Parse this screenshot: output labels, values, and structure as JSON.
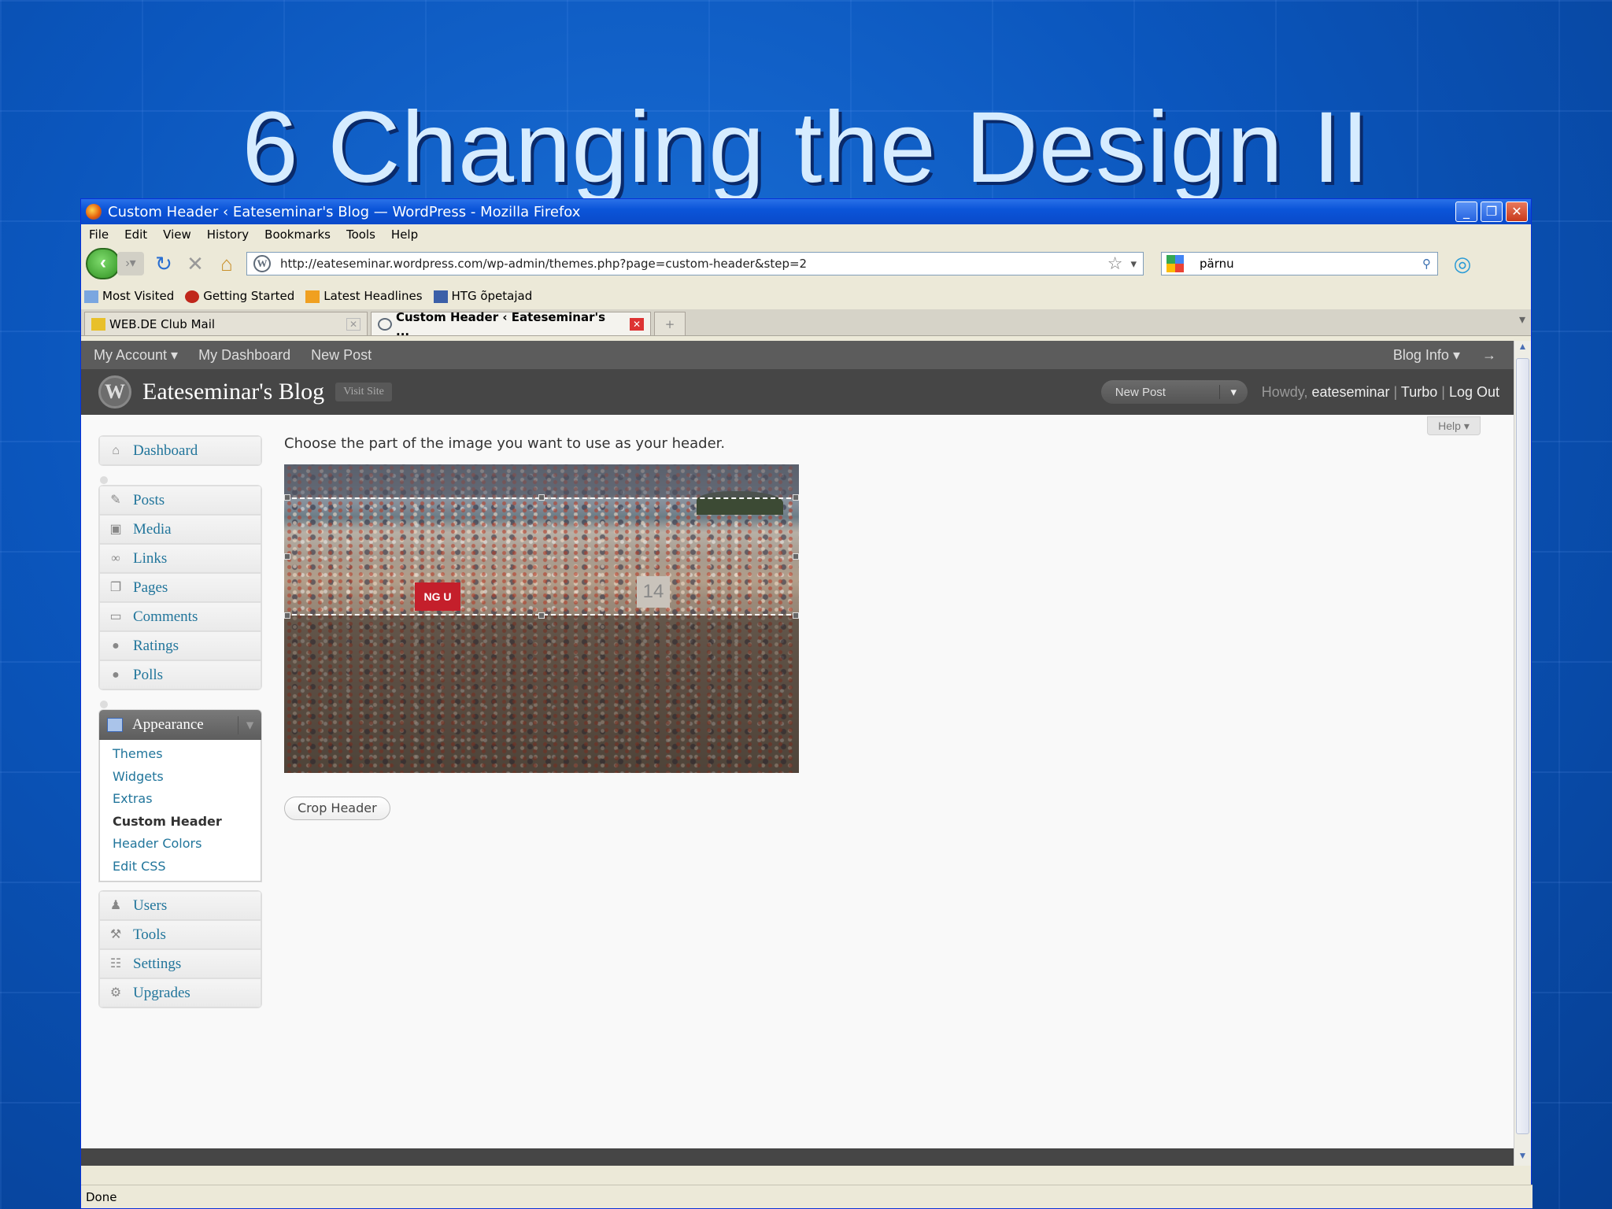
{
  "slide": {
    "title": "6 Changing the Design II"
  },
  "browser": {
    "window_title": "Custom Header ‹ Eateseminar's Blog — WordPress - Mozilla Firefox",
    "menu": [
      "File",
      "Edit",
      "View",
      "History",
      "Bookmarks",
      "Tools",
      "Help"
    ],
    "url": "http://eateseminar.wordpress.com/wp-admin/themes.php?page=custom-header&step=2",
    "search_value": "pärnu",
    "bookmarks": [
      "Most Visited",
      "Getting Started",
      "Latest Headlines",
      "HTG õpetajad"
    ],
    "tabs": [
      {
        "label": "WEB.DE Club Mail",
        "active": false
      },
      {
        "label": "Custom Header ‹ Eateseminar's ...",
        "active": true
      }
    ],
    "status": "Done"
  },
  "admin_bar": {
    "left": [
      "My Account",
      "My Dashboard",
      "New Post"
    ],
    "right": [
      "Blog Info",
      "→"
    ]
  },
  "wp_header": {
    "blog_name": "Eateseminar's Blog",
    "visit_site": "Visit Site",
    "new_post": "New Post",
    "howdy_prefix": "Howdy,",
    "username": "eateseminar",
    "links": [
      "Turbo",
      "Log Out"
    ],
    "help": "Help"
  },
  "sidebar": {
    "dashboard": "Dashboard",
    "group1": [
      "Posts",
      "Media",
      "Links",
      "Pages",
      "Comments",
      "Ratings",
      "Polls"
    ],
    "appearance": "Appearance",
    "appearance_sub": [
      "Themes",
      "Widgets",
      "Extras",
      "Custom Header",
      "Header Colors",
      "Edit CSS"
    ],
    "group3": [
      "Users",
      "Tools",
      "Settings",
      "Upgrades"
    ]
  },
  "main": {
    "instruction": "Choose the part of the image you want to use as your header.",
    "crop_button": "Crop Header",
    "photo_sign": "NG U",
    "photo_number": "14"
  },
  "colors": {
    "accent_link": "#21759b",
    "xp_title_blue": "#0b55d9"
  }
}
